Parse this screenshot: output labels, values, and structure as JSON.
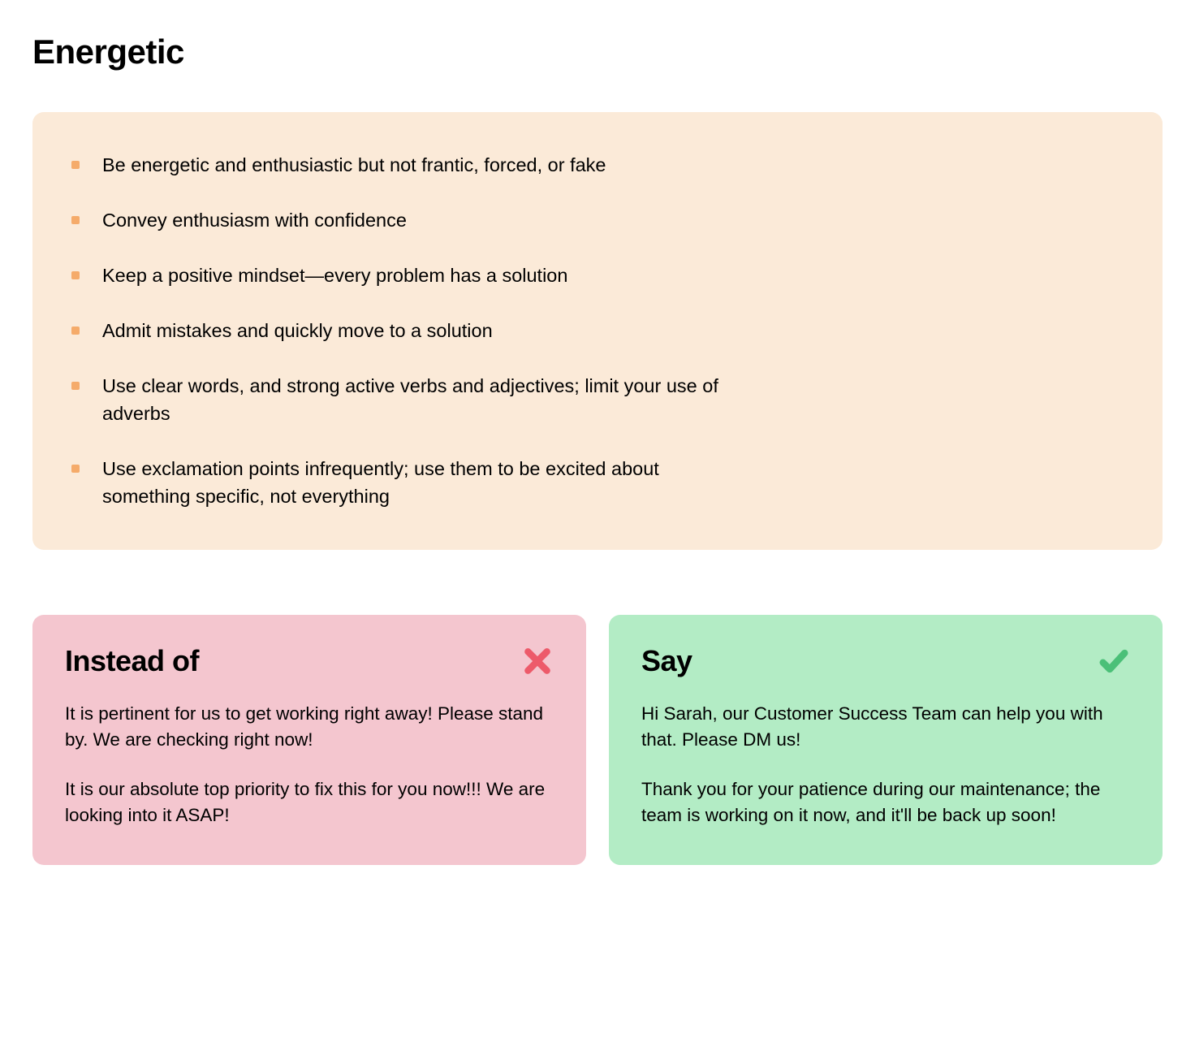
{
  "title": "Energetic",
  "guidelines": [
    "Be energetic and enthusiastic but not frantic, forced, or fake",
    "Convey enthusiasm with confidence",
    "Keep a positive mindset—every problem has a solution",
    "Admit mistakes and quickly move to a solution",
    "Use clear words, and strong active verbs and adjectives; limit your use of adverbs",
    "Use exclamation points infrequently; use them to be excited about something specific, not everything"
  ],
  "examples": {
    "bad": {
      "title": "Instead of",
      "paragraphs": [
        "It is pertinent for us to get working right away! Please stand by. We are checking right now!",
        "It is our absolute top priority to fix this for you now!!! We are looking into it ASAP!"
      ]
    },
    "good": {
      "title": "Say",
      "paragraphs": [
        "Hi Sarah, our Customer Success Team can help you with that. Please DM us!",
        "Thank you for your patience during our maintenance; the team is working on it now, and it'll be back up soon!"
      ]
    }
  },
  "colors": {
    "guidelines_bg": "#fbead8",
    "bullet": "#f5ab6a",
    "bad_bg": "#f4c6cf",
    "good_bg": "#b3ecc5",
    "x_icon": "#ed5a6a",
    "check_icon": "#4bc078"
  }
}
